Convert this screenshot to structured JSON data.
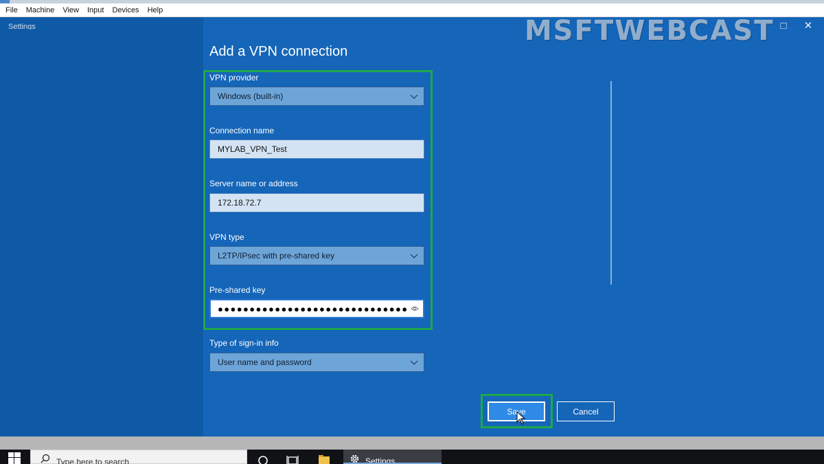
{
  "vm_menu": [
    "File",
    "Machine",
    "View",
    "Input",
    "Devices",
    "Help"
  ],
  "window": {
    "title": "Settings",
    "watermark": "MSFTWEBCAST"
  },
  "dialog": {
    "title": "Add a VPN connection",
    "vpn_provider": {
      "label": "VPN provider",
      "value": "Windows (built-in)"
    },
    "connection_name": {
      "label": "Connection name",
      "value": "MYLAB_VPN_Test"
    },
    "server_address": {
      "label": "Server name or address",
      "value": "172.18.72.7"
    },
    "vpn_type": {
      "label": "VPN type",
      "value": "L2TP/IPsec with pre-shared key"
    },
    "pre_shared_key": {
      "label": "Pre-shared key",
      "value": "●●●●●●●●●●●●●●●●●●●●●●●●●●●●●●"
    },
    "sign_in_type": {
      "label": "Type of sign-in info",
      "value": "User name and password"
    },
    "save_label": "Save",
    "cancel_label": "Cancel"
  },
  "taskbar": {
    "search_placeholder": "Type here to search",
    "settings_app": "Settings"
  },
  "colors": {
    "accent": "#1565b8",
    "highlight": "#1fa84a",
    "button": "#2e8ae6"
  }
}
